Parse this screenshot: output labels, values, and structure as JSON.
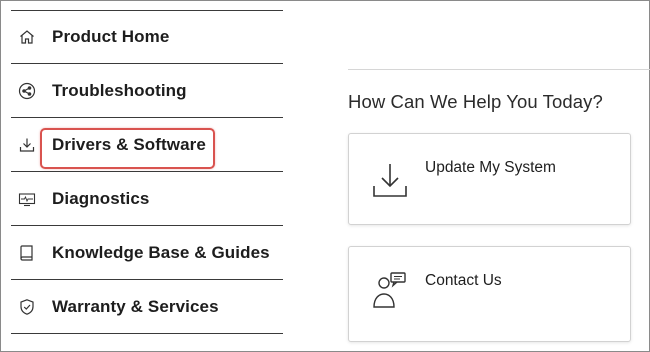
{
  "sidebar": {
    "items": [
      {
        "label": "Product Home",
        "icon": "home-icon"
      },
      {
        "label": "Troubleshooting",
        "icon": "share-icon"
      },
      {
        "label": "Drivers & Software",
        "icon": "download-icon",
        "highlighted": true
      },
      {
        "label": "Diagnostics",
        "icon": "diagnostics-monitor-icon"
      },
      {
        "label": "Knowledge Base & Guides",
        "icon": "book-icon"
      },
      {
        "label": "Warranty & Services",
        "icon": "shield-check-icon"
      }
    ],
    "highlight_color": "#d9534f"
  },
  "main": {
    "title": "How Can We Help You Today?",
    "cards": [
      {
        "label": "Update My System",
        "icon": "download-tray-icon"
      },
      {
        "label": "Contact Us",
        "icon": "contact-person-chat-icon"
      }
    ]
  }
}
